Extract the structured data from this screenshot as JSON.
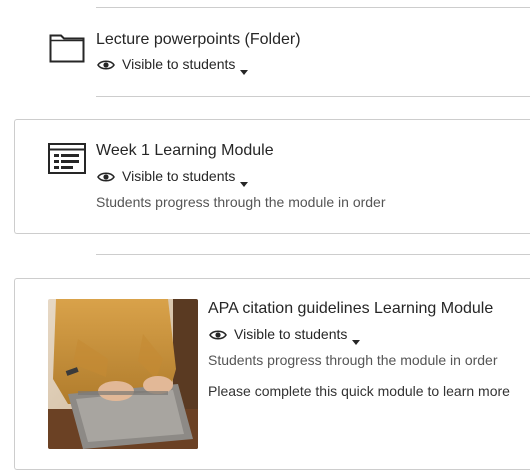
{
  "items": [
    {
      "title": "Lecture powerpoints (Folder)",
      "visibility": "Visible to students",
      "icon": "folder-icon"
    },
    {
      "title": "Week 1 Learning Module",
      "visibility": "Visible to students",
      "description": "Students progress through the module in order",
      "icon": "learning-module-icon"
    },
    {
      "title": "APA citation guidelines Learning Module",
      "visibility": "Visible to students",
      "description": "Students progress through the module in order",
      "note": "Please complete this quick module to learn more",
      "image": "laptop-typing-thumbnail"
    }
  ],
  "icons": {
    "visibility": "eye-icon",
    "dropdown": "chevron-down-icon"
  },
  "colors": {
    "text": "#262626",
    "muted": "#555555",
    "border": "#cdcdcd"
  }
}
